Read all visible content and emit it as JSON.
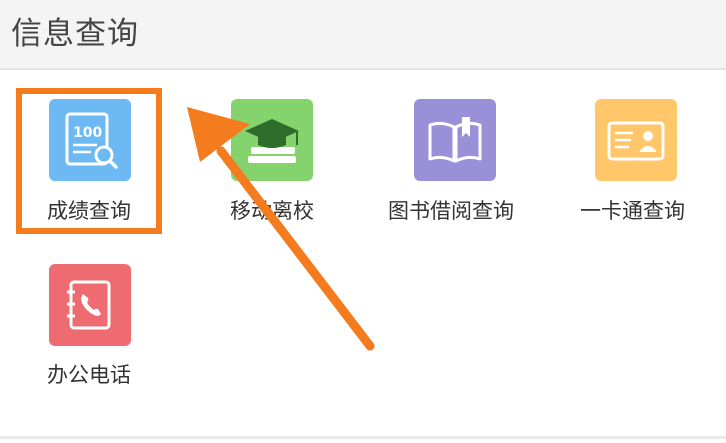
{
  "header": {
    "title": "信息查询"
  },
  "tiles": [
    {
      "label": "成绩查询",
      "color": "#6cb9f4",
      "icon": "score-report-icon"
    },
    {
      "label": "移动离校",
      "color": "#85d36c",
      "icon": "graduation-cap-icon"
    },
    {
      "label": "图书借阅查询",
      "color": "#9a90d8",
      "icon": "book-icon"
    },
    {
      "label": "一卡通查询",
      "color": "#ffc66a",
      "icon": "id-card-icon"
    },
    {
      "label": "办公电话",
      "color": "#ef6b72",
      "icon": "phone-book-icon"
    }
  ],
  "annotation": {
    "highlight_color": "#f47b1e"
  }
}
